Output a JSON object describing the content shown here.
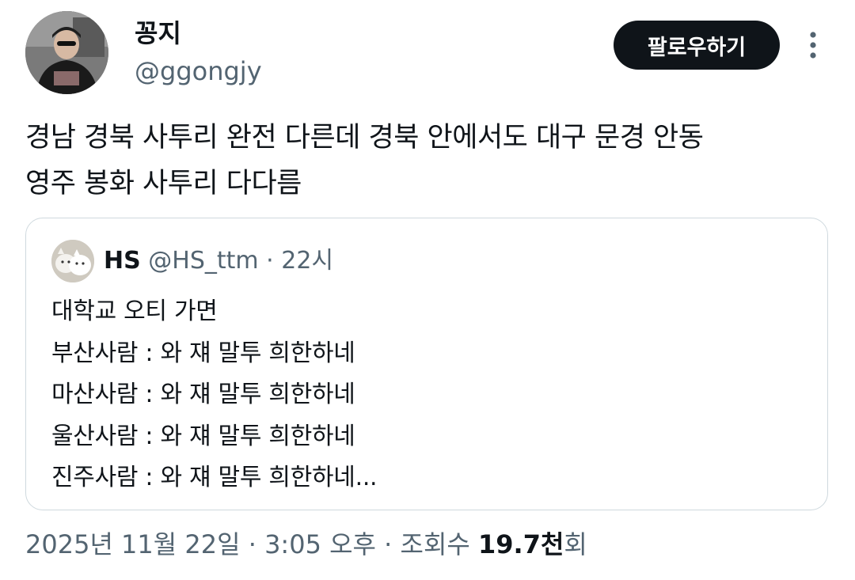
{
  "author": {
    "display_name": "꽁지",
    "handle": "@ggongjy"
  },
  "follow_label": "팔로우하기",
  "tweet": {
    "lines": [
      "경남 경북 사투리 완전 다른데 경북 안에서도 대구 문경 안동",
      "영주 봉화 사투리 다다름"
    ]
  },
  "quoted": {
    "name": "HS",
    "handle": "@HS_ttm",
    "dot": "·",
    "time": "22시",
    "lines": [
      "대학교 오티 가면",
      "부산사람 : 와 쟤 말투 희한하네",
      "마산사람 : 와 쟤 말투 희한하네",
      "울산사람 : 와 쟤 말투 희한하네",
      "진주사람 : 와 쟤 말투 희한하네..."
    ]
  },
  "meta": {
    "date": "2025년 11월 22일",
    "sep1": "·",
    "time": "3:05 오후",
    "sep2": "·",
    "views_label": "조회수",
    "views_count": "19.7천",
    "views_suffix": "회"
  },
  "icons": {
    "more": "more-vertical-icon"
  },
  "colors": {
    "text_primary": "#0f1419",
    "text_secondary": "#536471",
    "border": "#cfd9de",
    "follow_bg": "#0f1419"
  }
}
